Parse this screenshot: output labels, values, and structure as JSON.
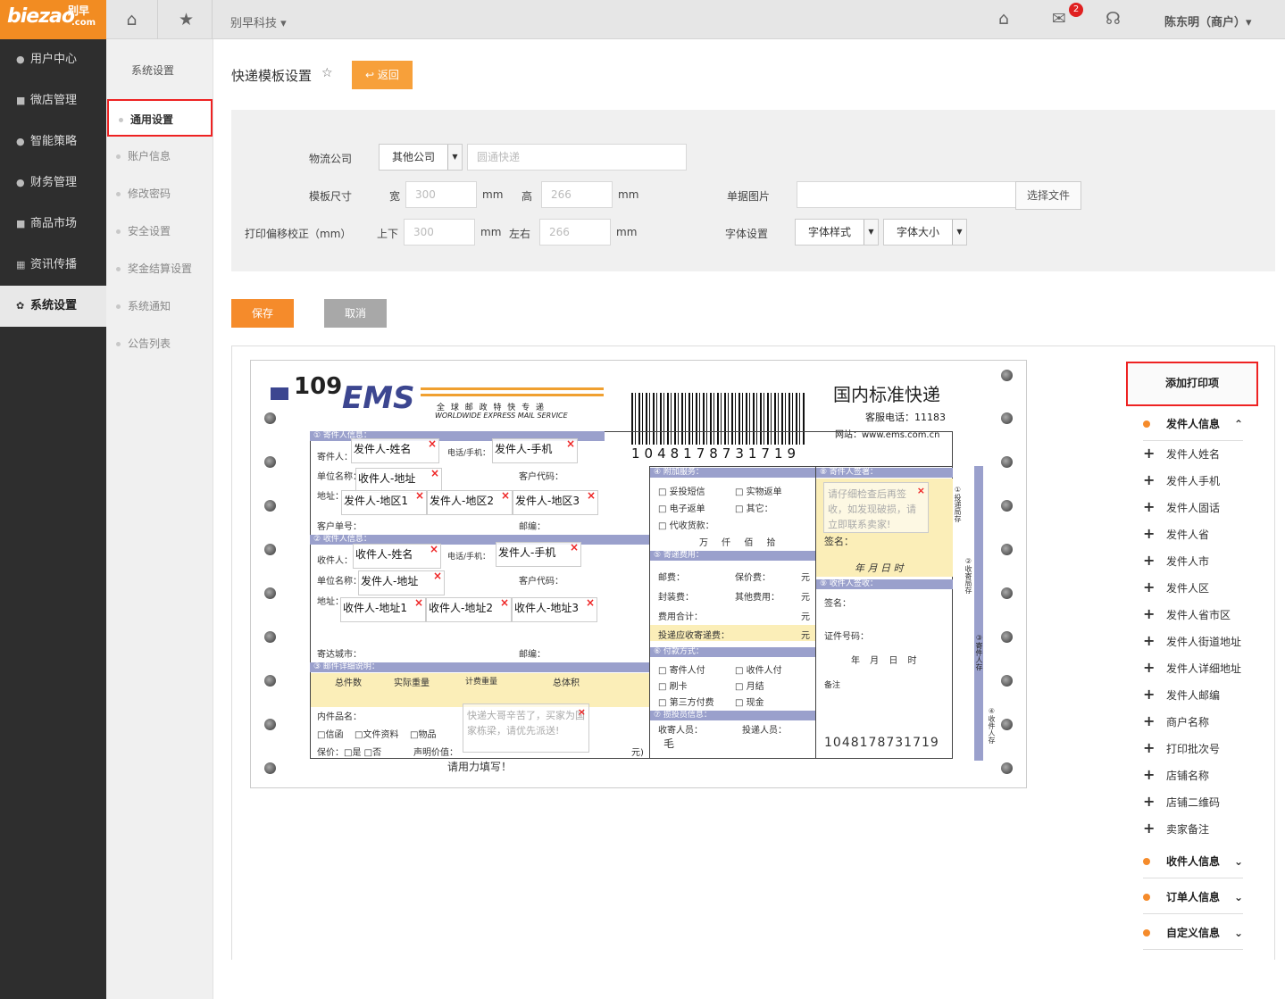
{
  "brand": {
    "logo_main": "biezao",
    "logo_cn": "别早",
    "logo_sub": ".com",
    "company": "别早科技 ▾"
  },
  "topbar": {
    "user": "陈东明（商户）▾",
    "mail_badge": "2"
  },
  "nav": [
    "用户中心",
    "微店管理",
    "智能策略",
    "财务管理",
    "商品市场",
    "资讯传播",
    "系统设置"
  ],
  "subnav": {
    "title": "系统设置",
    "items": [
      "通用设置",
      "账户信息",
      "修改密码",
      "安全设置",
      "奖金结算设置",
      "系统通知",
      "公告列表"
    ]
  },
  "page": {
    "title": "快递模板设置",
    "back": "返回",
    "save": "保存",
    "cancel": "取消"
  },
  "form": {
    "logistics_label": "物流公司",
    "logistics_select": "其他公司",
    "logistics_placeholder": "圆通快递",
    "size_label": "模板尺寸",
    "width_label": "宽",
    "width_ph": "300",
    "height_label": "高",
    "height_ph": "266",
    "mm": "mm",
    "offset_label": "打印偏移校正（mm）",
    "vertical_label": "上下",
    "vertical_ph": "300",
    "horizontal_label": "左右",
    "horizontal_ph": "266",
    "image_label": "单据图片",
    "choose_file": "选择文件",
    "font_label": "字体设置",
    "font_style": "字体样式",
    "font_size": "字体大小"
  },
  "waybill": {
    "num": "109",
    "ems": "EMS",
    "ems_cn": "全 球 邮 政 特 快 专 递",
    "ems_en": "WORLDWIDE EXPRESS MAIL SERVICE",
    "title_cn": "国内标准快递",
    "hotline": "客服电话：11183",
    "website": "网站：www.ems.com.cn",
    "barcode_num": "1048178731719",
    "barcode_num2": "1048178731719",
    "sec1": "① 寄件人信息：",
    "sec2": "② 收件人信息：",
    "sec3": "③ 邮件详细说明：",
    "sec4": "④ 附加服务：",
    "sec5": "⑤ 寄递费用：",
    "sec6": "⑥ 付款方式：",
    "sec7": "⑦ 揽投员信息：",
    "sec8": "⑧ 寄件人签署：",
    "sec9": "⑨ 收件人签收：",
    "lbl_sender": "寄件人：",
    "lbl_phone": "电话/手机：",
    "lbl_unit": "单位名称：",
    "lbl_cust": "客户代码：",
    "lbl_addr": "地址：",
    "lbl_custno": "客户单号：",
    "lbl_zip": "邮编：",
    "lbl_receiver": "收件人：",
    "lbl_phone2": "电话/手机：",
    "lbl_unit2": "单位名称：",
    "lbl_cust2": "客户代码：",
    "lbl_addr2": "地址：",
    "lbl_city": "寄达城市：",
    "lbl_zip2": "邮编：",
    "lbl_total": "总件数",
    "lbl_weight": "实际重量",
    "lbl_charge": "计费重量",
    "lbl_volume": "总体积",
    "lbl_content": "内件品名：",
    "lbl_letter": "□信函",
    "lbl_doc": "□文件资料",
    "lbl_goods": "□物品",
    "lbl_insure": "保价：□是 □否",
    "lbl_value": "声明价值：",
    "lbl_yuan": "元)",
    "lbl_hint": "请用力填写！",
    "svc1": "□ 妥投短信",
    "svc2": "□ 实物返单",
    "svc3": "□ 电子返单",
    "svc4": "□ 其它：",
    "svc5": "□ 代收货款：",
    "svc_units": "万  仟  佰  拾",
    "fee1": "邮费：",
    "fee2": "保价费：",
    "fee3": "封装费：",
    "fee4": "其他费用：",
    "fee5": "费用合计：",
    "fee6": "投递应收寄递费：",
    "yuan": "元",
    "pay1": "□ 寄件人付",
    "pay2": "□ 收件人付",
    "pay3": "□ 刷卡",
    "pay4": "□ 月结",
    "pay5": "□ 第三方付费",
    "pay6": "□ 现金",
    "courier1": "收寄人员：",
    "courier2": "投递人员：",
    "courier_val": "毛",
    "sign_label": "签名：",
    "date_label": "年  月  日  时",
    "id_label": "证件号码：",
    "remark": "备注",
    "sign_date": "年   月   日   时",
    "sign_name": "签名：",
    "f_sender_name": "发件人-姓名",
    "f_sender_phone": "发件人-手机",
    "f_recv_addr": "收件人-地址",
    "f_s_area1": "发件人-地区1",
    "f_s_area2": "发件人-地区2",
    "f_s_area3": "发件人-地区3",
    "f_recv_name": "收件人-姓名",
    "f_recv_phone": "发件人-手机",
    "f_send_addr": "发件人-地址",
    "f_r_addr1": "收件人-地址1",
    "f_r_addr2": "收件人-地址2",
    "f_r_addr3": "收件人-地址3",
    "note1": "请仔细检查后再签收，如发现破损，请立即联系卖家!",
    "note2": "快递大哥辛苦了，买家为国家栋梁，请优先派送!",
    "close": "×",
    "side1": "①投递局存",
    "side2": "②收寄局存",
    "side3": "③寄件人存",
    "side4": "④收件人存"
  },
  "print_items": {
    "header": "添加打印项",
    "groups": [
      {
        "label": "发件人信息",
        "chev": "⌃"
      },
      {
        "label": "收件人信息",
        "chev": "⌄"
      },
      {
        "label": "订单人信息",
        "chev": "⌄"
      },
      {
        "label": "自定义信息",
        "chev": "⌄"
      }
    ],
    "items": [
      "发件人姓名",
      "发件人手机",
      "发件人固话",
      "发件人省",
      "发件人市",
      "发件人区",
      "发件人省市区",
      "发件人街道地址",
      "发件人详细地址",
      "发件人邮编",
      "商户名称",
      "打印批次号",
      "店铺名称",
      "店铺二维码",
      "卖家备注"
    ]
  },
  "icons": {
    "home": "home-icon",
    "star": "star-icon",
    "mail": "mail-icon",
    "support": "headset-icon"
  },
  "colors": {
    "accent": "#f58b2b",
    "sidebar": "#2e2e2e",
    "highlight": "#e22222"
  }
}
